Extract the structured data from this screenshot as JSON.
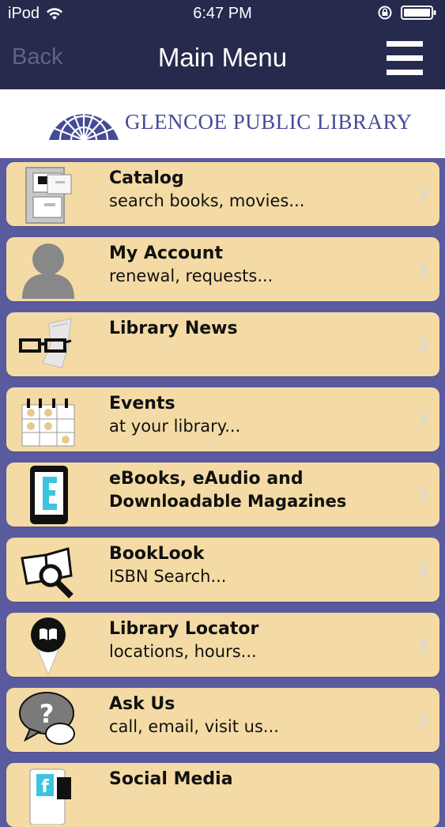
{
  "status_bar": {
    "carrier": "iPod",
    "time": "6:47 PM"
  },
  "nav": {
    "back_label": "Back",
    "title": "Main Menu"
  },
  "banner": {
    "library_name": "GLENCOE PUBLIC LIBRARY"
  },
  "menu": {
    "items": [
      {
        "title": "Catalog",
        "subtitle": "search books, movies...",
        "icon": "file-cabinet-icon"
      },
      {
        "title": "My Account",
        "subtitle": "renewal, requests...",
        "icon": "person-icon"
      },
      {
        "title": "Library News",
        "subtitle": "",
        "icon": "glasses-newspaper-icon"
      },
      {
        "title": "Events",
        "subtitle": "at your library...",
        "icon": "calendar-icon"
      },
      {
        "title": "eBooks, eAudio and",
        "subtitle": "Downloadable Magazines",
        "icon": "ereader-icon"
      },
      {
        "title": "BookLook",
        "subtitle": "ISBN Search...",
        "icon": "book-magnifier-icon"
      },
      {
        "title": "Library Locator",
        "subtitle": "locations, hours...",
        "icon": "map-pin-icon"
      },
      {
        "title": "Ask Us",
        "subtitle": "call, email, visit us...",
        "icon": "speech-bubble-icon"
      },
      {
        "title": "Social Media",
        "subtitle": "",
        "icon": "social-media-icon"
      }
    ]
  },
  "colors": {
    "header_bg": "#262a4d",
    "page_bg": "#5a5a9e",
    "item_bg": "#f4dba5",
    "brand_blue": "#464b97"
  }
}
